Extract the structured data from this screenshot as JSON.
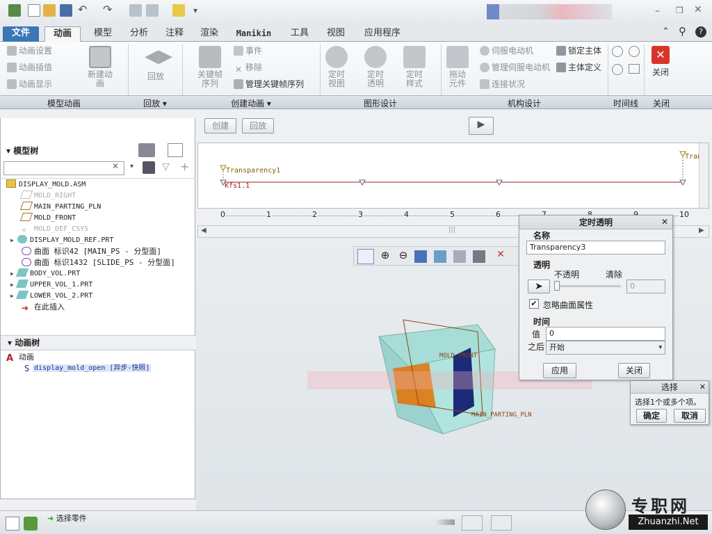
{
  "tabs": {
    "file": "文件",
    "items": [
      "动画",
      "模型",
      "分析",
      "注释",
      "渲染",
      "Manikin",
      "工具",
      "视图",
      "应用程序"
    ]
  },
  "ribbon": {
    "model_anim": {
      "items": [
        "动画设置",
        "动画插值",
        "动画显示"
      ],
      "new_anim": "新建动",
      "new_anim2": "画",
      "group": "模型动画"
    },
    "playback": {
      "label": "回放",
      "group": "回放"
    },
    "create": {
      "keyframe1": "关键帧",
      "keyframe2": "序列",
      "event": "事件",
      "remove": "移除",
      "manage_kf": "管理关键帧序列",
      "group": "创建动画"
    },
    "graphic": {
      "items": [
        [
          "定时",
          "视图"
        ],
        [
          "定时",
          "透明"
        ],
        [
          "定时",
          "样式"
        ]
      ],
      "group": "图形设计"
    },
    "mech": {
      "drag1": "拖动",
      "drag2": "元件",
      "servo": "伺服电动机",
      "manage_servo": "管理伺服电动机",
      "conn": "连接状况",
      "lock": "锁定主体",
      "body_def": "主体定义",
      "group": "机构设计"
    },
    "timeline_group": "时间线",
    "close": {
      "label": "关闭",
      "group": "关闭"
    }
  },
  "subtoolbar": {
    "create": "创建",
    "playback": "回放"
  },
  "model_tree": {
    "title": "模型树",
    "rows": [
      {
        "text": "DISPLAY_MOLD.ASM",
        "gray": false
      },
      {
        "text": "MOLD_RIGHT",
        "gray": true
      },
      {
        "text": "MAIN_PARTING_PLN",
        "gray": false
      },
      {
        "text": "MOLD_FRONT",
        "gray": false
      },
      {
        "text": "MOLD_DEF_CSYS",
        "gray": true
      },
      {
        "text": "DISPLAY_MOLD_REF.PRT",
        "gray": false
      },
      {
        "text": "曲面 标识42 [MAIN_PS - 分型面]",
        "gray": false
      },
      {
        "text": "曲面 标识1432 [SLIDE_PS - 分型面]",
        "gray": false
      },
      {
        "text": "BODY_VOL.PRT",
        "gray": false
      },
      {
        "text": "UPPER_VOL_1.PRT",
        "gray": false
      },
      {
        "text": "LOWER_VOL_2.PRT",
        "gray": false
      },
      {
        "text": "在此插入",
        "gray": false
      }
    ]
  },
  "anim_tree": {
    "title": "动画树",
    "root": "动画",
    "child": "display_mold_open [异步-快照]"
  },
  "timeline": {
    "label1": "Transparency1",
    "label2": "Kfs1.1",
    "label3": "Tran",
    "ticks": [
      "0",
      "1",
      "2",
      "3",
      "4",
      "5",
      "6",
      "7",
      "8",
      "9",
      "10"
    ]
  },
  "viewport": {
    "label1": "MOLD_FRONT",
    "label2": "MAIN_PARTING_PLN"
  },
  "dialog": {
    "title": "定时透明",
    "name_section": "名称",
    "name_value": "Transparency3",
    "trans_section": "透明",
    "opaque": "不透明",
    "clear": "清除",
    "trans_value": "0",
    "ignore_surface": "忽略曲面属性",
    "time_section": "时间",
    "value_label": "值",
    "value": "0",
    "after_label": "之后",
    "after_value": "开始",
    "apply": "应用",
    "close": "关闭"
  },
  "select_dialog": {
    "title": "选择",
    "message": "选择1个或多个项。",
    "ok": "确定",
    "cancel": "取消"
  },
  "status": {
    "message": "选择零件"
  },
  "watermark": {
    "text1": "专职网",
    "text2": "Zhuanzhi.Net"
  }
}
